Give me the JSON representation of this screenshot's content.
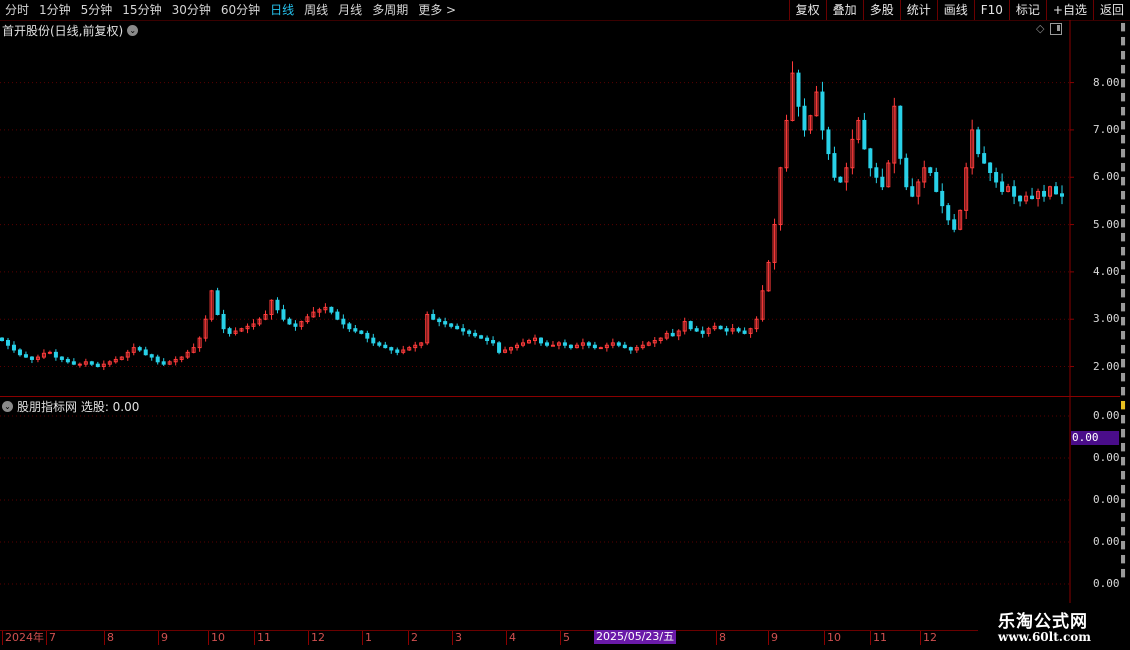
{
  "toolbar": {
    "periods": [
      "分时",
      "1分钟",
      "5分钟",
      "15分钟",
      "30分钟",
      "60分钟",
      "日线",
      "周线",
      "月线",
      "多周期",
      "更多 >"
    ],
    "active_period": "日线",
    "actions": [
      "复权",
      "叠加",
      "多股",
      "统计",
      "画线",
      "F10",
      "标记",
      "+自选",
      "返回"
    ]
  },
  "main_panel": {
    "title": "首开股份(日线,前复权)",
    "price_ticks": [
      "8.00",
      "7.00",
      "6.00",
      "5.00",
      "4.00",
      "3.00",
      "2.00"
    ]
  },
  "sub_panel": {
    "title": "股朋指标网 选股: 0.00",
    "ticks": [
      "0.00",
      "0.00",
      "0.00",
      "0.00",
      "0.00"
    ],
    "current_value": "0.00"
  },
  "timeline": {
    "labels": [
      "2024年",
      "7",
      "8",
      "9",
      "10",
      "11",
      "12",
      "1",
      "2",
      "3",
      "4",
      "5",
      "8",
      "9",
      "10",
      "11",
      "12"
    ],
    "highlight": "2025/05/23/五"
  },
  "watermark": {
    "title": "乐淘公式网",
    "url": "www.60lt.com"
  },
  "colors": {
    "up": "#ff3b3b",
    "down": "#29d1e8",
    "grid": "#5a0000",
    "active_tab": "#26c4f0",
    "highlight": "#6a1aa8"
  },
  "chart_data": {
    "type": "candlestick",
    "title": "首开股份(日线,前复权)",
    "ylim": [
      1.8,
      8.9
    ],
    "close_series": [
      2.55,
      2.45,
      2.35,
      2.25,
      2.2,
      2.15,
      2.2,
      2.28,
      2.3,
      2.2,
      2.15,
      2.1,
      2.05,
      2.05,
      2.1,
      2.05,
      2.0,
      2.05,
      2.1,
      2.15,
      2.2,
      2.3,
      2.4,
      2.35,
      2.25,
      2.2,
      2.1,
      2.05,
      2.1,
      2.15,
      2.2,
      2.3,
      2.4,
      2.6,
      3.0,
      3.6,
      3.1,
      2.8,
      2.7,
      2.75,
      2.8,
      2.85,
      2.9,
      3.0,
      3.1,
      3.4,
      3.2,
      3.0,
      2.9,
      2.85,
      2.95,
      3.05,
      3.15,
      3.2,
      3.25,
      3.15,
      3.0,
      2.9,
      2.8,
      2.75,
      2.7,
      2.6,
      2.5,
      2.45,
      2.4,
      2.35,
      2.3,
      2.35,
      2.4,
      2.45,
      2.5,
      3.1,
      3.0,
      2.95,
      2.9,
      2.85,
      2.8,
      2.75,
      2.7,
      2.65,
      2.6,
      2.55,
      2.5,
      2.3,
      2.35,
      2.4,
      2.45,
      2.5,
      2.55,
      2.6,
      2.5,
      2.45,
      2.45,
      2.5,
      2.45,
      2.4,
      2.45,
      2.5,
      2.45,
      2.4,
      2.4,
      2.45,
      2.5,
      2.45,
      2.4,
      2.35,
      2.4,
      2.45,
      2.5,
      2.55,
      2.6,
      2.7,
      2.65,
      2.75,
      2.95,
      2.8,
      2.75,
      2.7,
      2.8,
      2.85,
      2.8,
      2.75,
      2.8,
      2.75,
      2.7,
      2.8,
      3.0,
      3.6,
      4.2,
      5.0,
      6.2,
      7.2,
      8.2,
      7.5,
      7.0,
      7.3,
      7.8,
      7.0,
      6.5,
      6.0,
      5.9,
      6.2,
      6.8,
      7.2,
      6.6,
      6.2,
      6.0,
      5.8,
      6.3,
      7.5,
      6.4,
      5.8,
      5.6,
      5.9,
      6.2,
      6.1,
      5.7,
      5.4,
      5.1,
      4.9,
      5.3,
      6.2,
      7.0,
      6.5,
      6.3,
      6.1,
      5.9,
      5.7,
      5.8,
      5.6,
      5.5,
      5.6,
      5.55,
      5.7,
      5.6,
      5.8,
      5.65,
      5.6
    ]
  }
}
